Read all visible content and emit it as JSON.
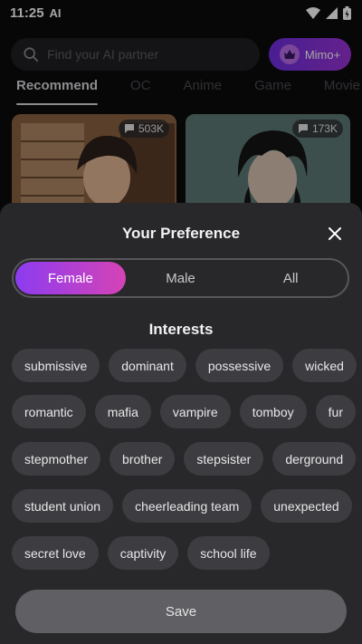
{
  "status_bar": {
    "time": "11:25",
    "ai_badge": "AI"
  },
  "search": {
    "placeholder": "Find your AI partner"
  },
  "premium_button": {
    "label": "Mimo+"
  },
  "tabs": [
    {
      "label": "Recommend",
      "active": true
    },
    {
      "label": "OC",
      "active": false
    },
    {
      "label": "Anime",
      "active": false
    },
    {
      "label": "Game",
      "active": false
    },
    {
      "label": "Movie",
      "active": false
    }
  ],
  "cards": [
    {
      "count": "503K"
    },
    {
      "count": "173K"
    }
  ],
  "preference_sheet": {
    "title": "Your Preference",
    "gender_options": [
      "Female",
      "Male",
      "All"
    ],
    "selected_gender": "Female",
    "interests_title": "Interests",
    "interest_rows": [
      [
        "submissive",
        "dominant",
        "possessive",
        "wicked"
      ],
      [
        "romantic",
        "mafia",
        "vampire",
        "tomboy",
        "fur"
      ],
      [
        "stepmother",
        "brother",
        "stepsister",
        "derground"
      ],
      [
        "student union",
        "cheerleading team",
        "unexpected"
      ],
      [
        "secret love",
        "captivity",
        "school life"
      ]
    ],
    "save_label": "Save"
  }
}
